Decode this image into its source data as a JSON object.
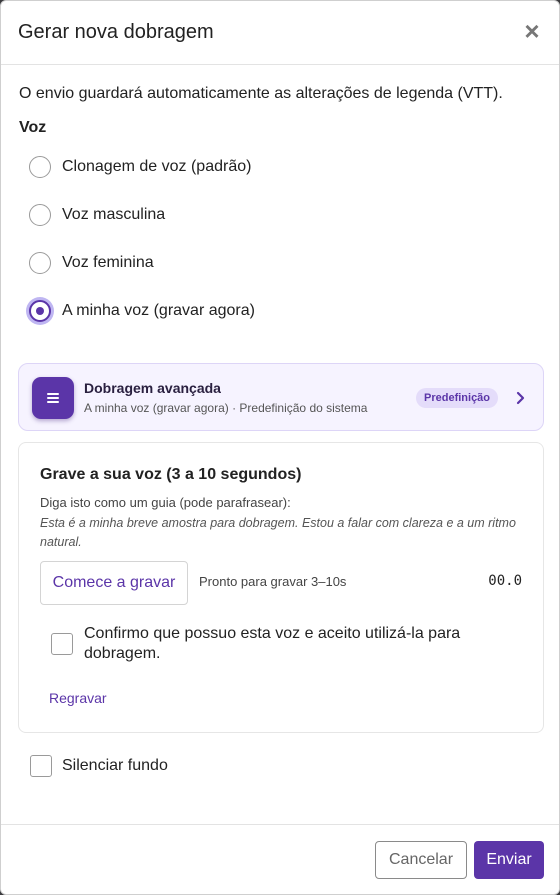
{
  "dialog": {
    "title": "Gerar nova dobragem",
    "close_icon": "×",
    "intro": "O envio guardará automaticamente as alterações de legenda (VTT)."
  },
  "voice": {
    "label": "Voz",
    "options": [
      {
        "label": "Clonagem de voz (padrão)",
        "selected": false
      },
      {
        "label": "Voz masculina",
        "selected": false
      },
      {
        "label": "Voz feminina",
        "selected": false
      },
      {
        "label": "A minha voz (gravar agora)",
        "selected": true
      }
    ]
  },
  "advanced": {
    "icon": "list-icon",
    "title": "Dobragem avançada",
    "subtitle": "A minha voz (gravar agora) · Predefinição do sistema",
    "badge": "Predefinição",
    "chevron_icon": "chevron-right-icon"
  },
  "recording": {
    "title": "Grave a sua voz (3 a 10 segundos)",
    "hint": "Diga isto como um guia (pode parafrasear):",
    "script": "Esta é a minha breve amostra para dobragem. Estou a falar com clareza e a um ritmo natural.",
    "start_button": "Comece a gravar",
    "status": "Pronto para gravar 3–10s",
    "timer": "00.0",
    "confirm_label": "Confirmo que possuo esta voz e aceito utilizá-la para dobragem.",
    "confirm_checked": false,
    "rerecord_link": "Regravar"
  },
  "mute_background": {
    "label": "Silenciar fundo",
    "checked": false
  },
  "footer": {
    "cancel": "Cancelar",
    "submit": "Enviar"
  },
  "colors": {
    "accent": "#5b35a8",
    "card_bg": "#f6f3ff",
    "badge_bg": "#e4dcfa"
  }
}
